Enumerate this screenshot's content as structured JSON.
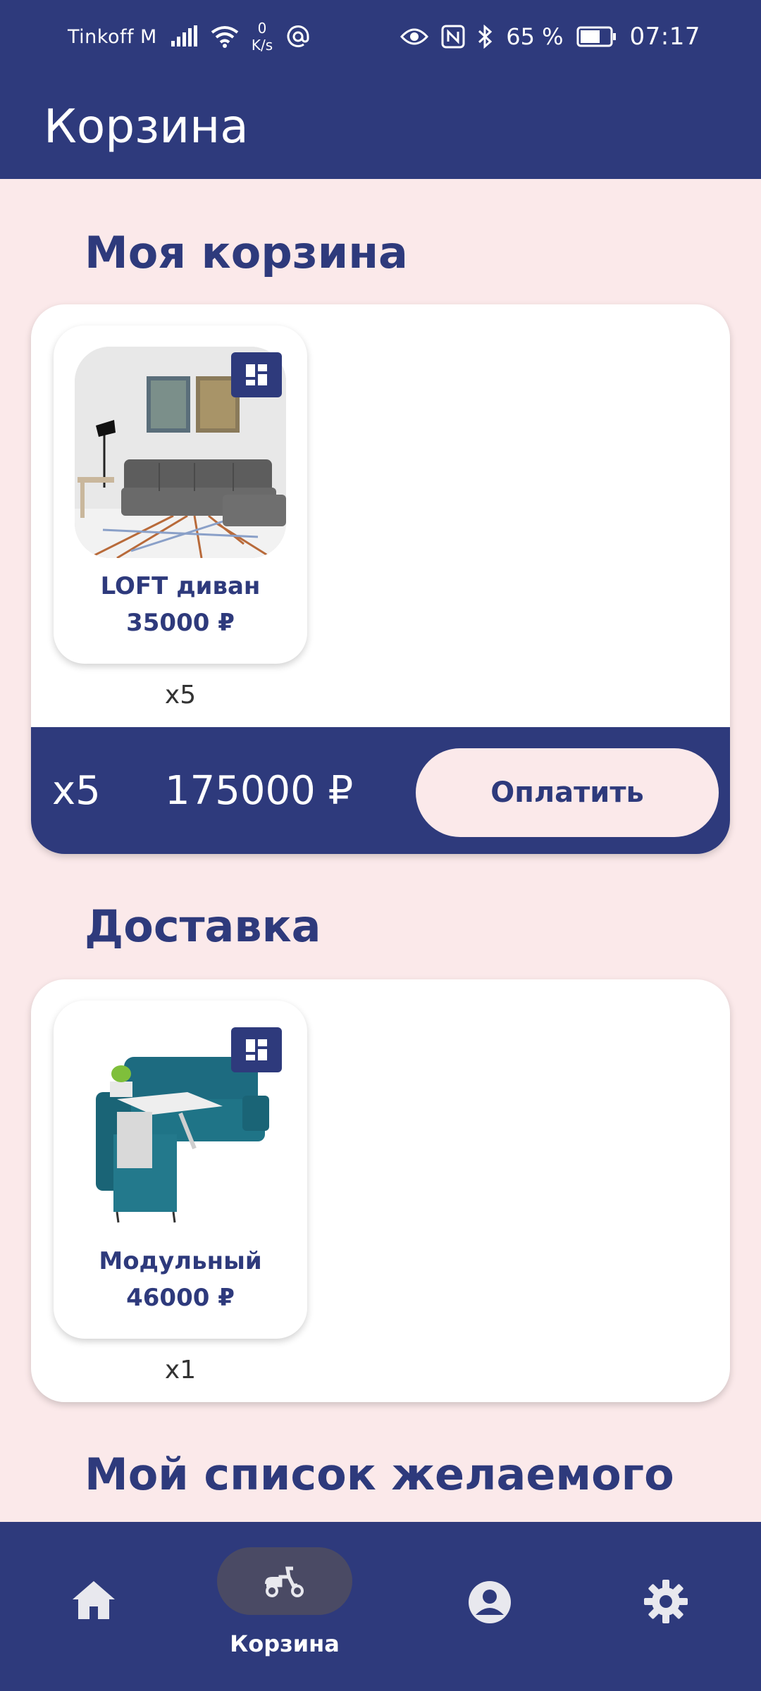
{
  "status_bar": {
    "carrier": "Tinkoff M",
    "net_speed_value": "0",
    "net_speed_unit": "K/s",
    "battery": "65 %",
    "time": "07:17"
  },
  "app_bar": {
    "title": "Корзина"
  },
  "cart": {
    "heading": "Моя корзина",
    "items": [
      {
        "name": "LOFT диван",
        "price": "35000 ₽",
        "quantity": "x5"
      }
    ],
    "total_quantity": "x5",
    "total_price": "175000 ₽",
    "pay_label": "Оплатить"
  },
  "delivery": {
    "heading": "Доставка",
    "items": [
      {
        "name": "Модульный",
        "price": "46000 ₽",
        "quantity": "x1"
      }
    ]
  },
  "wishlist": {
    "heading": "Мой список желаемого"
  },
  "bottom_nav": {
    "items": [
      {
        "icon": "home-icon",
        "label": ""
      },
      {
        "icon": "scooter-icon",
        "label": "Корзина",
        "active": true
      },
      {
        "icon": "account-icon",
        "label": ""
      },
      {
        "icon": "settings-icon",
        "label": ""
      }
    ]
  },
  "colors": {
    "primary": "#2e3a7c",
    "background": "#fbe9ea",
    "surface": "#ffffff"
  }
}
